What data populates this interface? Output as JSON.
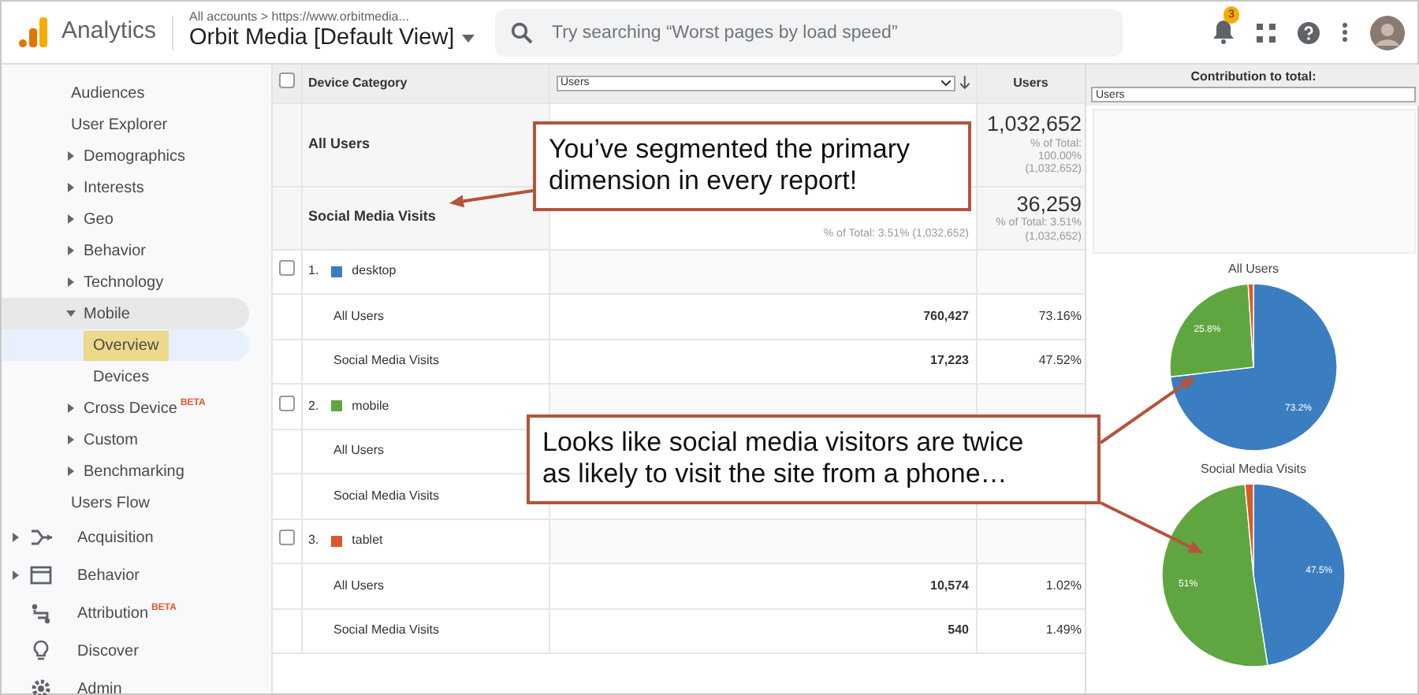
{
  "header": {
    "product": "Analytics",
    "breadcrumb": "All accounts > https://www.orbitmedia...",
    "view": "Orbit Media [Default View]",
    "search": {
      "placeholder": "Try searching “Worst pages by load speed”"
    },
    "notification_count": "3"
  },
  "sidebar": {
    "items": [
      {
        "label": "Audiences",
        "kind": "link",
        "expanded": false
      },
      {
        "label": "User Explorer",
        "kind": "link",
        "expanded": false
      },
      {
        "label": "Demographics",
        "kind": "group",
        "expanded": false
      },
      {
        "label": "Interests",
        "kind": "group",
        "expanded": false
      },
      {
        "label": "Geo",
        "kind": "group",
        "expanded": false
      },
      {
        "label": "Behavior",
        "kind": "group",
        "expanded": false
      },
      {
        "label": "Technology",
        "kind": "group",
        "expanded": false
      },
      {
        "label": "Mobile",
        "kind": "group",
        "expanded": true,
        "children": [
          {
            "label": "Overview",
            "selected": true
          },
          {
            "label": "Devices",
            "selected": false
          }
        ]
      },
      {
        "label": "Cross Device",
        "kind": "group",
        "expanded": false,
        "badge": "BETA"
      },
      {
        "label": "Custom",
        "kind": "group",
        "expanded": false
      },
      {
        "label": "Benchmarking",
        "kind": "group",
        "expanded": false
      },
      {
        "label": "Users Flow",
        "kind": "link",
        "expanded": false
      }
    ],
    "sections": [
      {
        "label": "Acquisition",
        "kind": "group"
      },
      {
        "label": "Behavior",
        "kind": "group"
      },
      {
        "label": "Attribution",
        "kind": "link",
        "badge": "BETA"
      },
      {
        "label": "Discover",
        "kind": "link"
      },
      {
        "label": "Admin",
        "kind": "link"
      }
    ]
  },
  "table": {
    "select_all_checked": false,
    "columns": [
      "Device Category",
      "Users",
      "Users"
    ],
    "rows": [
      {
        "kind": "summary",
        "label": "All Users",
        "value": "1,032,652",
        "share_lines": [
          "% of Total:",
          "100.00%",
          "(1,032,652)"
        ]
      },
      {
        "kind": "summary",
        "label": "Social Media Visits",
        "note": "% of Total: 3.51% (1,032,652)",
        "value": "36,259",
        "share_lines": [
          "% of Total: 3.51%",
          "(1,032,652)"
        ]
      },
      {
        "kind": "group",
        "checked": false,
        "index": "1.",
        "label": "desktop",
        "color": "#3b7dc1"
      },
      {
        "kind": "segment",
        "label": "All Users",
        "value": "760,427",
        "share": "73.16%"
      },
      {
        "kind": "segment",
        "label": "Social Media Visits",
        "value": "17,223",
        "share": "47.52%"
      },
      {
        "kind": "group",
        "checked": false,
        "index": "2.",
        "label": "mobile",
        "color": "#5fa640"
      },
      {
        "kind": "segment",
        "label": "All Users"
      },
      {
        "kind": "segment",
        "label": "Social Media Visits"
      },
      {
        "kind": "group",
        "checked": false,
        "index": "3.",
        "label": "tablet",
        "color": "#d9582c"
      },
      {
        "kind": "segment",
        "label": "All Users",
        "value": "10,574",
        "share": "1.02%"
      },
      {
        "kind": "segment",
        "label": "Social Media Visits",
        "value": "540",
        "share": "1.49%"
      }
    ]
  },
  "contribution": {
    "title": "Contribution to total:",
    "metric": "Users",
    "charts": [
      {
        "chart_data": {
          "type": "pie",
          "title": "All Users",
          "values": [
            73.16,
            25.82,
            1.02
          ],
          "value_labels": [
            "73.2%",
            "25.8%",
            null
          ]
        }
      },
      {
        "chart_data": {
          "type": "pie",
          "title": "Social Media Visits",
          "values": [
            47.52,
            50.99,
            1.49
          ],
          "value_labels": [
            "47.5%",
            "51%",
            null
          ]
        }
      }
    ]
  },
  "annotations": [
    {
      "text": "You’ve segmented the primary dimension in every report!"
    },
    {
      "text": "Looks like social media visitors are twice as likely to visit the site from a phone…"
    }
  ]
}
